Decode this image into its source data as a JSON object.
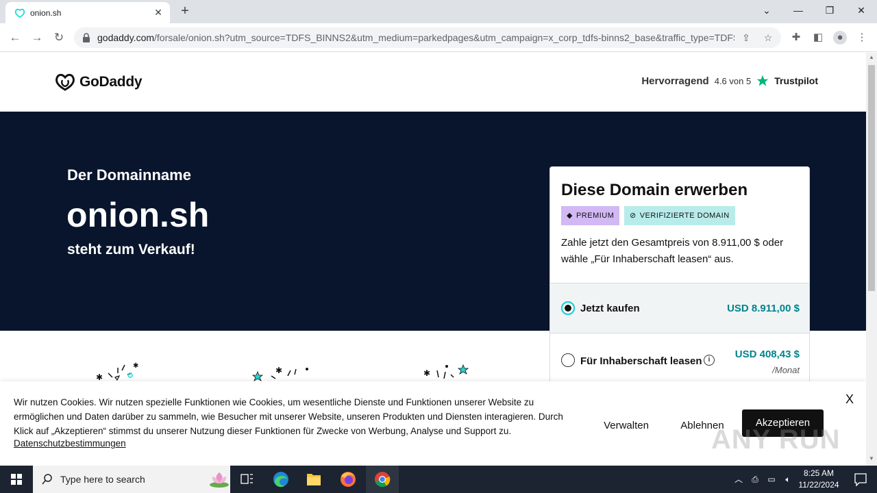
{
  "browser": {
    "tab_title": "onion.sh",
    "url_host": "godaddy.com",
    "url_path": "/forsale/onion.sh?utm_source=TDFS_BINNS2&utm_medium=parkedpages&utm_campaign=x_corp_tdfs-binns2_base&traffic_type=TDFS..."
  },
  "header": {
    "logo_text": "GoDaddy",
    "rating_word": "Hervorragend",
    "rating_score": "4.6 von 5",
    "trustpilot": "Trustpilot"
  },
  "hero": {
    "pre": "Der Domainname",
    "domain": "onion.sh",
    "post": "steht zum Verkauf!"
  },
  "card": {
    "title": "Diese Domain erwerben",
    "badge_premium": "PREMIUM",
    "badge_verified": "VERIFIZIERTE DOMAIN",
    "description": "Zahle jetzt den Gesamtpreis von 8.911,00 $ oder wähle „Für Inhaberschaft leasen“ aus.",
    "buy_label": "Jetzt kaufen",
    "buy_price": "USD 8.911,00 $",
    "lease_label": "Für Inhaberschaft leasen",
    "lease_price": "USD 408,43 $",
    "lease_period": "/Monat",
    "buy_selected": true
  },
  "cookie": {
    "text": "Wir nutzen Cookies. Wir nutzen spezielle Funktionen wie Cookies, um wesentliche Dienste und Funktionen unserer Website zu ermöglichen und Daten darüber zu sammeln, wie Besucher mit unserer Website, unseren Produkten und Diensten interagieren. Durch Klick auf „Akzeptieren“ stimmst du unserer Nutzung dieser Funktionen für Zwecke von Werbung, Analyse und Support zu.",
    "link": "Datenschutzbestimmungen",
    "manage": "Verwalten",
    "reject": "Ablehnen",
    "accept": "Akzeptieren",
    "close": "X"
  },
  "taskbar": {
    "search_placeholder": "Type here to search",
    "time": "8:25 AM",
    "date": "11/22/2024"
  },
  "colors": {
    "hero_bg": "#09152c",
    "price_teal": "#00838c",
    "premium_badge": "#d2b8f5",
    "verified_badge": "#b8ecea"
  }
}
